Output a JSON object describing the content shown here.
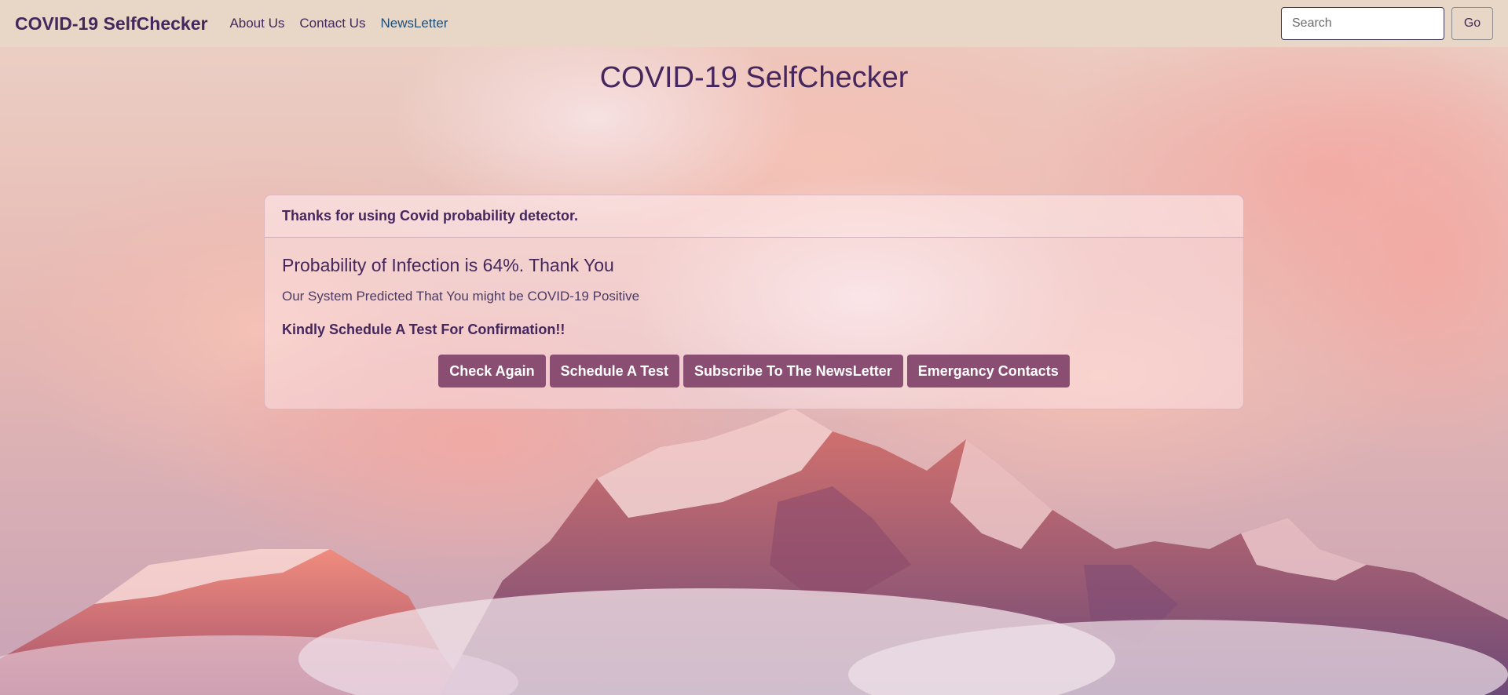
{
  "navbar": {
    "brand": "COVID-19 SelfChecker",
    "links": [
      {
        "label": "About Us"
      },
      {
        "label": "Contact Us"
      },
      {
        "label": "NewsLetter"
      }
    ],
    "search": {
      "placeholder": "Search",
      "value": ""
    },
    "go_label": "Go"
  },
  "page": {
    "title": "COVID-19 SelfChecker"
  },
  "result_card": {
    "header": "Thanks for using Covid probability detector.",
    "title": "Probability of Infection is 64%. Thank You",
    "text": "Our System Predicted That You might be COVID-19 Positive",
    "advice": "Kindly Schedule A Test For Confirmation!!",
    "buttons": [
      {
        "label": "Check Again"
      },
      {
        "label": "Schedule A Test"
      },
      {
        "label": "Subscribe To The NewsLetter"
      },
      {
        "label": "Emergancy Contacts"
      }
    ]
  },
  "colors": {
    "brand_text": "#45275d",
    "navbar_bg": "#e8d6c6",
    "button_bg": "#8a4e72",
    "active_link": "#1e4f78"
  }
}
